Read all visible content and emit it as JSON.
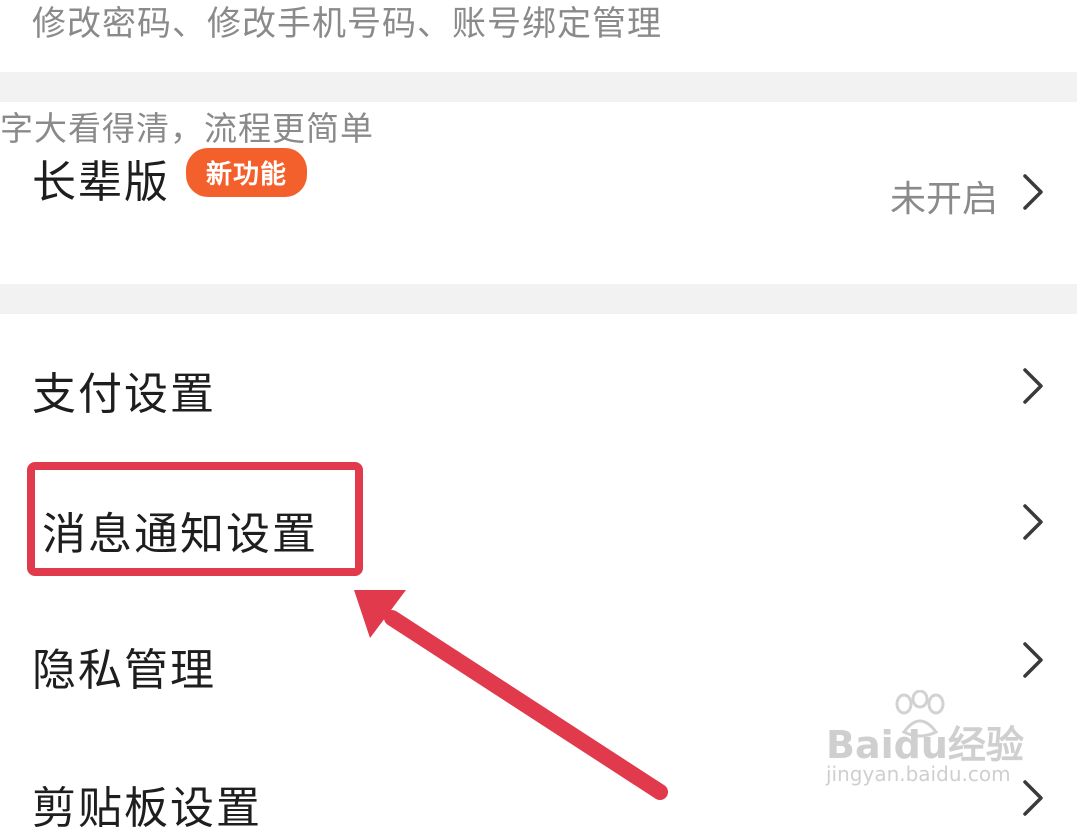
{
  "top_row": {
    "subtitle": "修改密码、修改手机号码、账号绑定管理"
  },
  "elder_mode": {
    "title": "长辈版",
    "badge": "新功能",
    "subtitle": "字大看得清，流程更简单",
    "status": "未开启"
  },
  "settings": [
    {
      "label": "支付设置"
    },
    {
      "label": "消息通知设置"
    },
    {
      "label": "隐私管理"
    },
    {
      "label": "剪贴板设置"
    }
  ],
  "annotation": {
    "color": "#e03a4c"
  },
  "watermark": {
    "brand": "Baidu经验",
    "url": "jingyan.baidu.com"
  },
  "colors": {
    "badge": "#f3602b",
    "divider": "#f2f2f2"
  }
}
